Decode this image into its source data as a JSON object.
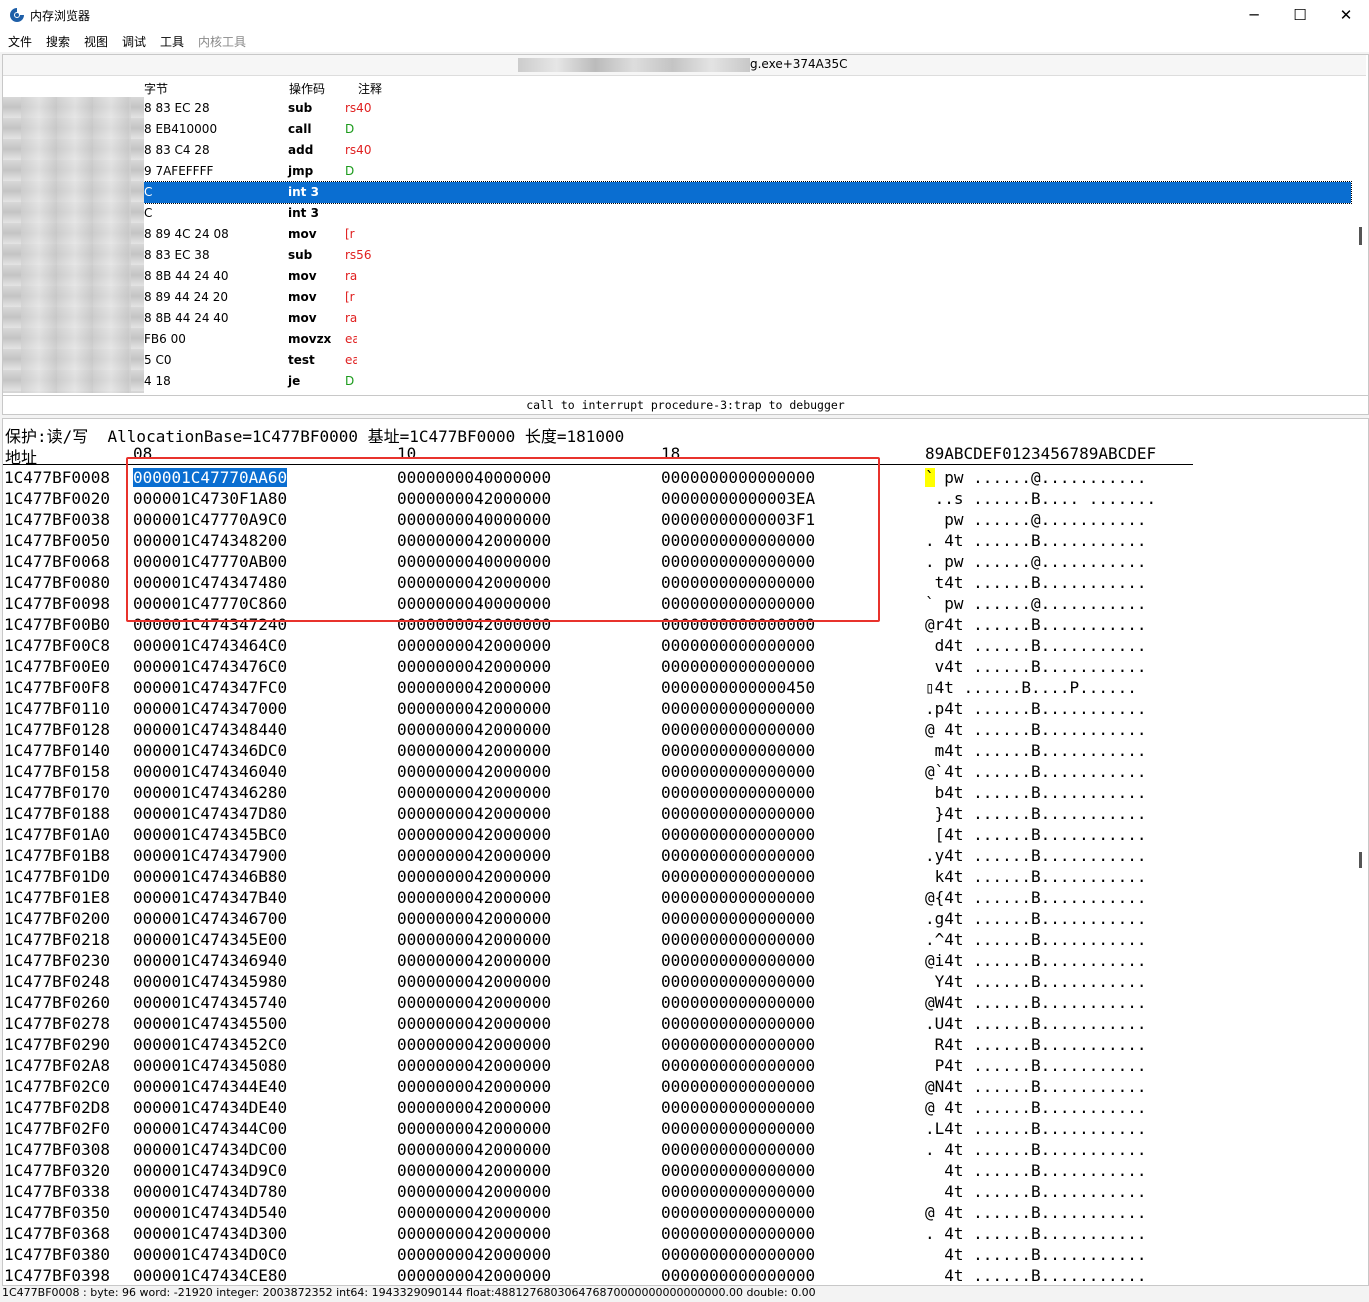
{
  "window": {
    "title": "内存浏览器",
    "buttons": {
      "minimize": "─",
      "maximize": "☐",
      "close": "✕"
    }
  },
  "menu": [
    "文件",
    "搜索",
    "视图",
    "调试",
    "工具",
    "内核工具"
  ],
  "disasm": {
    "address_suffix": "g.exe+374A35C",
    "headers": {
      "bytes": "字节",
      "opcode": "操作码",
      "comment": "注释"
    },
    "rows": [
      {
        "bytes": "8 83 EC 28",
        "op": "sub",
        "cm": "rs40",
        "cmcolor": "#e02020"
      },
      {
        "bytes": "8 EB410000",
        "op": "call",
        "cm": "D",
        "cmcolor": "#1a9a1a"
      },
      {
        "bytes": "8 83 C4 28",
        "op": "add",
        "cm": "rs40",
        "cmcolor": "#e02020"
      },
      {
        "bytes": "9 7AFEFFFF",
        "op": "jmp",
        "cm": "D",
        "cmcolor": "#1a9a1a"
      },
      {
        "bytes": "C",
        "op": "int 3",
        "cm": "",
        "cmcolor": "#000000",
        "selected": true
      },
      {
        "bytes": "C",
        "op": "int 3",
        "cm": "",
        "cmcolor": "#000000"
      },
      {
        "bytes": "8 89 4C 24 08",
        "op": "mov",
        "cm": "[r",
        "cmcolor": "#e02020"
      },
      {
        "bytes": "8 83 EC 38",
        "op": "sub",
        "cm": "rs56",
        "cmcolor": "#e02020"
      },
      {
        "bytes": "8 8B 44 24 40",
        "op": "mov",
        "cm": "ra",
        "cmcolor": "#e02020"
      },
      {
        "bytes": "8 89 44 24 20",
        "op": "mov",
        "cm": "[r",
        "cmcolor": "#e02020"
      },
      {
        "bytes": "8 8B 44 24 40",
        "op": "mov",
        "cm": "ra",
        "cmcolor": "#e02020"
      },
      {
        "bytes": "FB6 00",
        "op": "movzx",
        "cm": "ea",
        "cmcolor": "#e02020"
      },
      {
        "bytes": "5 C0",
        "op": "test",
        "cm": "ea",
        "cmcolor": "#e02020"
      },
      {
        "bytes": "4 18",
        "op": "je",
        "cm": "D",
        "cmcolor": "#1a9a1a"
      }
    ]
  },
  "status_line": "call to interrupt procedure-3:trap to debugger",
  "hex": {
    "info": "保护:读/写  AllocationBase=1C477BF0000 基址=1C477BF0000 长度=181000",
    "header": {
      "addr": "地址",
      "c1": "08",
      "c2": "10",
      "c3": "18",
      "ascii": "89ABCDEF0123456789ABCDEF"
    },
    "rows": [
      [
        "1C477BF0008",
        "000001C47770AA60",
        "0000000040000000",
        "0000000000000000",
        "` pw ......@..........."
      ],
      [
        "1C477BF0020",
        "000001C4730F1A80",
        "0000000042000000",
        "00000000000003EA",
        " ..s ......B.... ......."
      ],
      [
        "1C477BF0038",
        "000001C47770A9C0",
        "0000000040000000",
        "00000000000003F1",
        "  pw ......@..........."
      ],
      [
        "1C477BF0050",
        "000001C474348200",
        "0000000042000000",
        "0000000000000000",
        ". 4t ......B..........."
      ],
      [
        "1C477BF0068",
        "000001C47770AB00",
        "0000000040000000",
        "0000000000000000",
        ". pw ......@..........."
      ],
      [
        "1C477BF0080",
        "000001C474347480",
        "0000000042000000",
        "0000000000000000",
        " t4t ......B..........."
      ],
      [
        "1C477BF0098",
        "000001C47770C860",
        "0000000040000000",
        "0000000000000000",
        "` pw ......@..........."
      ],
      [
        "1C477BF00B0",
        "000001C474347240",
        "0000000042000000",
        "0000000000000000",
        "@r4t ......B..........."
      ],
      [
        "1C477BF00C8",
        "000001C4743464C0",
        "0000000042000000",
        "0000000000000000",
        " d4t ......B..........."
      ],
      [
        "1C477BF00E0",
        "000001C4743476C0",
        "0000000042000000",
        "0000000000000000",
        " v4t ......B..........."
      ],
      [
        "1C477BF00F8",
        "000001C474347FC0",
        "0000000042000000",
        "0000000000000450",
        "▯4t ......B....P......"
      ],
      [
        "1C477BF0110",
        "000001C474347000",
        "0000000042000000",
        "0000000000000000",
        ".p4t ......B..........."
      ],
      [
        "1C477BF0128",
        "000001C474348440",
        "0000000042000000",
        "0000000000000000",
        "@ 4t ......B..........."
      ],
      [
        "1C477BF0140",
        "000001C474346DC0",
        "0000000042000000",
        "0000000000000000",
        " m4t ......B..........."
      ],
      [
        "1C477BF0158",
        "000001C474346040",
        "0000000042000000",
        "0000000000000000",
        "@`4t ......B..........."
      ],
      [
        "1C477BF0170",
        "000001C474346280",
        "0000000042000000",
        "0000000000000000",
        " b4t ......B..........."
      ],
      [
        "1C477BF0188",
        "000001C474347D80",
        "0000000042000000",
        "0000000000000000",
        " }4t ......B..........."
      ],
      [
        "1C477BF01A0",
        "000001C474345BC0",
        "0000000042000000",
        "0000000000000000",
        " [4t ......B..........."
      ],
      [
        "1C477BF01B8",
        "000001C474347900",
        "0000000042000000",
        "0000000000000000",
        ".y4t ......B..........."
      ],
      [
        "1C477BF01D0",
        "000001C474346B80",
        "0000000042000000",
        "0000000000000000",
        " k4t ......B..........."
      ],
      [
        "1C477BF01E8",
        "000001C474347B40",
        "0000000042000000",
        "0000000000000000",
        "@{4t ......B..........."
      ],
      [
        "1C477BF0200",
        "000001C474346700",
        "0000000042000000",
        "0000000000000000",
        ".g4t ......B..........."
      ],
      [
        "1C477BF0218",
        "000001C474345E00",
        "0000000042000000",
        "0000000000000000",
        ".^4t ......B..........."
      ],
      [
        "1C477BF0230",
        "000001C474346940",
        "0000000042000000",
        "0000000000000000",
        "@i4t ......B..........."
      ],
      [
        "1C477BF0248",
        "000001C474345980",
        "0000000042000000",
        "0000000000000000",
        " Y4t ......B..........."
      ],
      [
        "1C477BF0260",
        "000001C474345740",
        "0000000042000000",
        "0000000000000000",
        "@W4t ......B..........."
      ],
      [
        "1C477BF0278",
        "000001C474345500",
        "0000000042000000",
        "0000000000000000",
        ".U4t ......B..........."
      ],
      [
        "1C477BF0290",
        "000001C4743452C0",
        "0000000042000000",
        "0000000000000000",
        " R4t ......B..........."
      ],
      [
        "1C477BF02A8",
        "000001C474345080",
        "0000000042000000",
        "0000000000000000",
        " P4t ......B..........."
      ],
      [
        "1C477BF02C0",
        "000001C474344E40",
        "0000000042000000",
        "0000000000000000",
        "@N4t ......B..........."
      ],
      [
        "1C477BF02D8",
        "000001C47434DE40",
        "0000000042000000",
        "0000000000000000",
        "@ 4t ......B..........."
      ],
      [
        "1C477BF02F0",
        "000001C474344C00",
        "0000000042000000",
        "0000000000000000",
        ".L4t ......B..........."
      ],
      [
        "1C477BF0308",
        "000001C47434DC00",
        "0000000042000000",
        "0000000000000000",
        ". 4t ......B..........."
      ],
      [
        "1C477BF0320",
        "000001C47434D9C0",
        "0000000042000000",
        "0000000000000000",
        "  4t ......B..........."
      ],
      [
        "1C477BF0338",
        "000001C47434D780",
        "0000000042000000",
        "0000000000000000",
        "  4t ......B..........."
      ],
      [
        "1C477BF0350",
        "000001C47434D540",
        "0000000042000000",
        "0000000000000000",
        "@ 4t ......B..........."
      ],
      [
        "1C477BF0368",
        "000001C47434D300",
        "0000000042000000",
        "0000000000000000",
        ". 4t ......B..........."
      ],
      [
        "1C477BF0380",
        "000001C47434D0C0",
        "0000000042000000",
        "0000000000000000",
        "  4t ......B..........."
      ],
      [
        "1C477BF0398",
        "000001C47434CE80",
        "0000000042000000",
        "0000000000000000",
        "  4t ......B..........."
      ]
    ]
  },
  "bottom_status": "1C477BF0008 : byte: 96 word: -21920 integer: 2003872352 int64: 1943329090144 float:488127680306476870000000000000000.00 double: 0.00",
  "colors": {
    "selection": "#0a6ed1",
    "highlight_box": "#e8322c",
    "ascii_highlight": "#ffff00"
  }
}
